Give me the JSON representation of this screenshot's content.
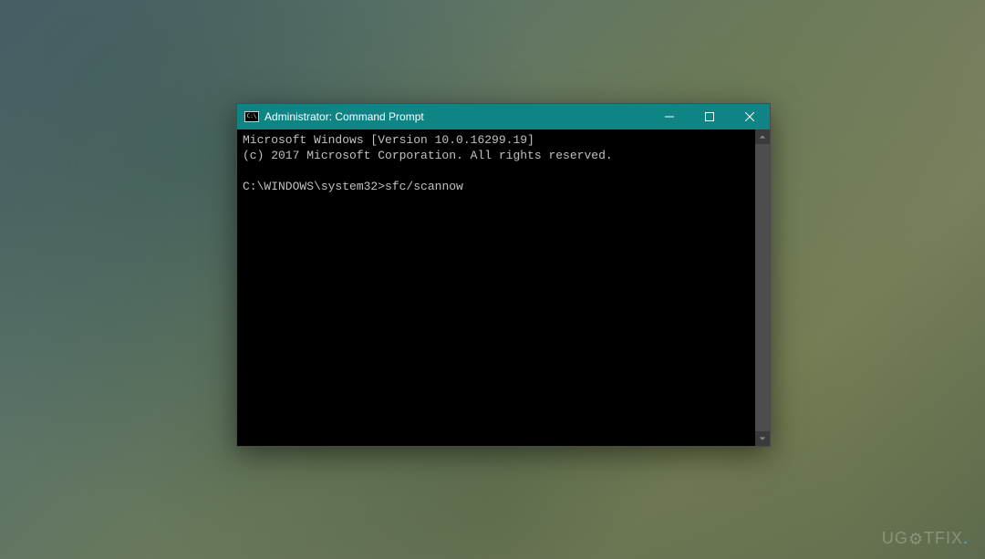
{
  "window": {
    "title": "Administrator: Command Prompt",
    "icon_text": "C:\\"
  },
  "console": {
    "line1": "Microsoft Windows [Version 10.0.16299.19]",
    "line2": "(c) 2017 Microsoft Corporation. All rights reserved.",
    "blank": "",
    "prompt": "C:\\WINDOWS\\system32>",
    "command": "sfc/scannow"
  },
  "watermark": {
    "text_before": "UG",
    "text_after": "TFIX"
  }
}
